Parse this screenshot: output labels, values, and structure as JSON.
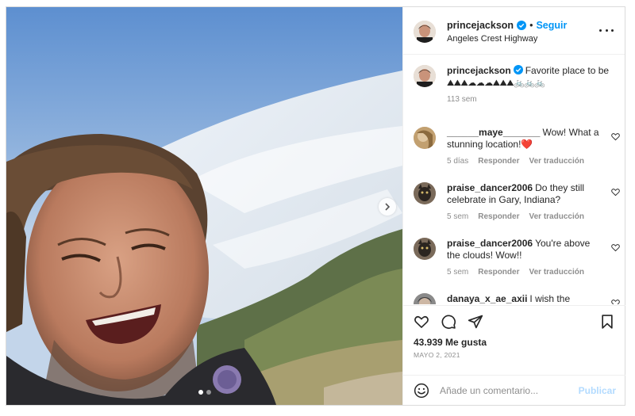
{
  "post": {
    "username": "princejackson",
    "follow_label": "Seguir",
    "separator": "•",
    "location": "Angeles Crest Highway",
    "caption_text": "Favorite place to be",
    "caption_emojis": "⛰⛰⛰☁☁☁⛰⛰⛰🚲🚲🚲",
    "caption_age": "113 sem"
  },
  "media": {
    "carousel_count": 2,
    "carousel_active": 1
  },
  "comments": [
    {
      "user": "______maye_______",
      "text": "Wow! What a stunning location!❤️",
      "age": "5 días",
      "reply": "Responder",
      "translate": "Ver traducción"
    },
    {
      "user": "praise_dancer2006",
      "text": "Do they still celebrate in Gary, Indiana?",
      "age": "5 sem",
      "reply": "Responder",
      "translate": "Ver traducción"
    },
    {
      "user": "praise_dancer2006",
      "text": "You're above the clouds! Wow!!",
      "age": "5 sem",
      "reply": "Responder",
      "translate": "Ver traducción"
    },
    {
      "user": "danaya_x_ae_axii",
      "text": "I wish the coolest and most unique man to make his",
      "age": "",
      "reply": "",
      "translate": ""
    }
  ],
  "actions": {
    "likes": "43.939 Me gusta",
    "date": "MAYO 2, 2021"
  },
  "composer": {
    "placeholder": "Añade un comentario...",
    "publish_label": "Publicar"
  },
  "colors": {
    "accent": "#0095f6",
    "publish_disabled": "#b3dbff",
    "muted": "#8e8e8e"
  }
}
